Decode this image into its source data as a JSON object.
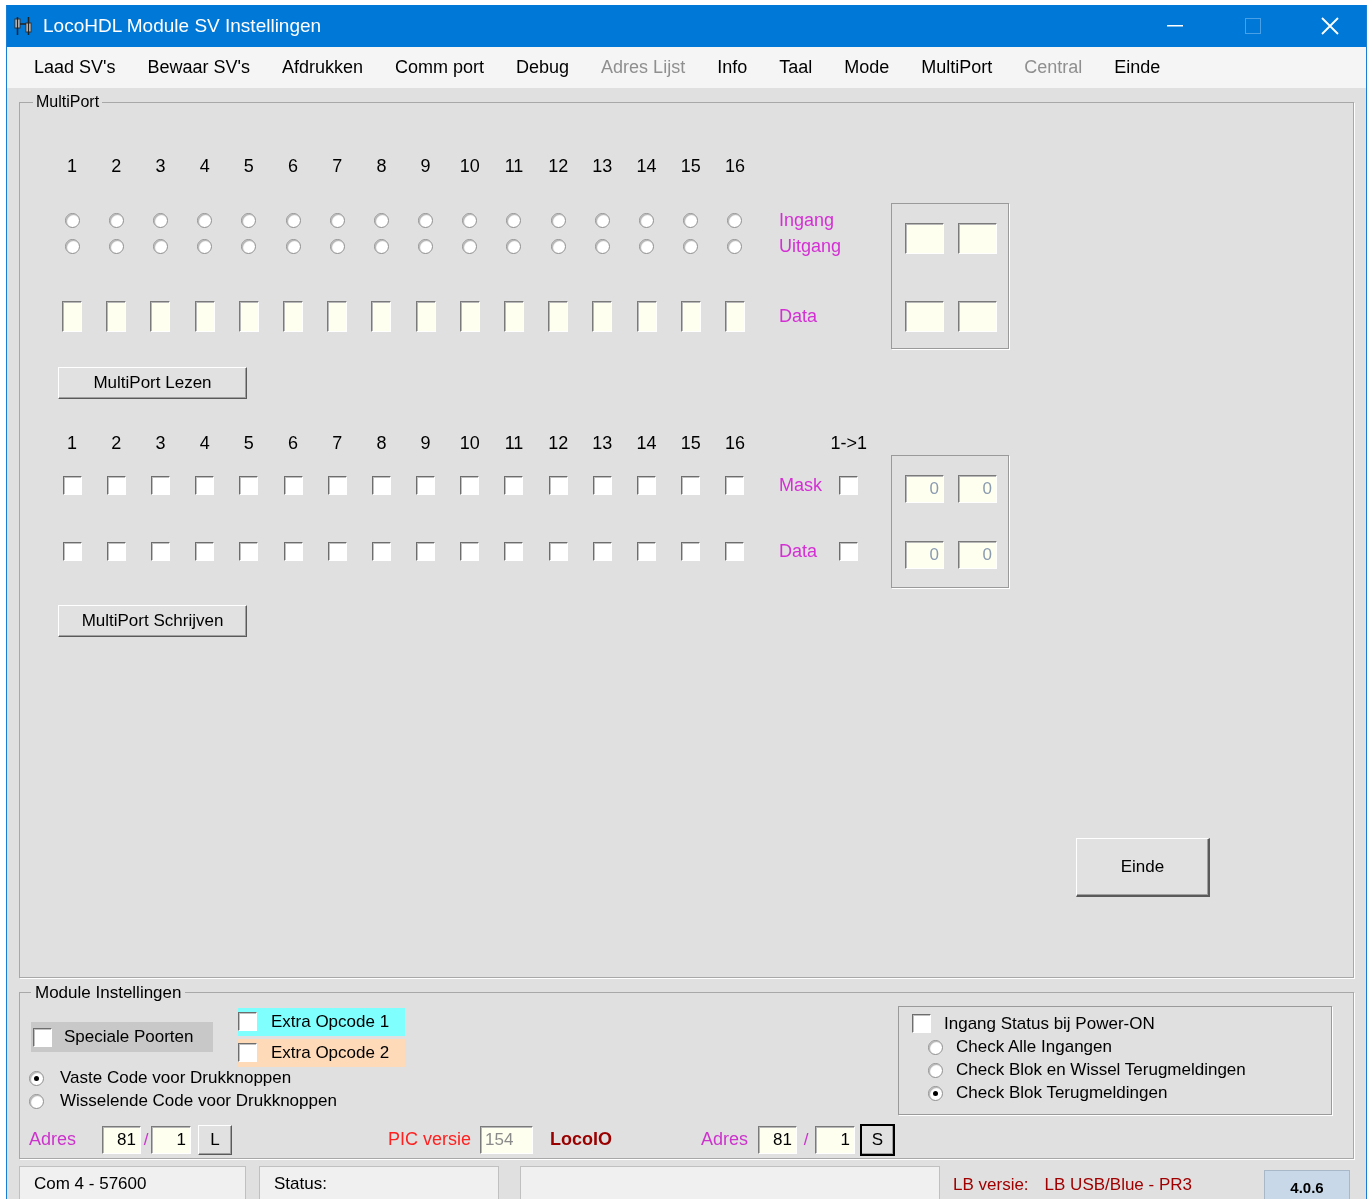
{
  "window": {
    "title": "LocoHDL Module SV Instellingen"
  },
  "menu": [
    {
      "label": "Laad SV's",
      "disabled": false
    },
    {
      "label": "Bewaar SV's",
      "disabled": false
    },
    {
      "label": "Afdrukken",
      "disabled": false
    },
    {
      "label": "Comm port",
      "disabled": false
    },
    {
      "label": "Debug",
      "disabled": false
    },
    {
      "label": "Adres Lijst",
      "disabled": true
    },
    {
      "label": "Info",
      "disabled": false
    },
    {
      "label": "Taal",
      "disabled": false
    },
    {
      "label": "Mode",
      "disabled": false
    },
    {
      "label": "MultiPort",
      "disabled": false
    },
    {
      "label": "Central",
      "disabled": true
    },
    {
      "label": "Einde",
      "disabled": false
    }
  ],
  "multiport": {
    "title": "MultiPort",
    "read": {
      "ports": [
        {
          "number": "1",
          "ingang": false,
          "uitgang": false
        },
        {
          "number": "2",
          "ingang": false,
          "uitgang": false
        },
        {
          "number": "3",
          "ingang": false,
          "uitgang": false
        },
        {
          "number": "4",
          "ingang": false,
          "uitgang": false
        },
        {
          "number": "5",
          "ingang": false,
          "uitgang": false
        },
        {
          "number": "6",
          "ingang": false,
          "uitgang": false
        },
        {
          "number": "7",
          "ingang": false,
          "uitgang": false
        },
        {
          "number": "8",
          "ingang": false,
          "uitgang": false
        },
        {
          "number": "9",
          "ingang": false,
          "uitgang": false
        },
        {
          "number": "10",
          "ingang": false,
          "uitgang": false
        },
        {
          "number": "11",
          "ingang": false,
          "uitgang": false
        },
        {
          "number": "12",
          "ingang": false,
          "uitgang": false
        },
        {
          "number": "13",
          "ingang": false,
          "uitgang": false
        },
        {
          "number": "14",
          "ingang": false,
          "uitgang": false
        },
        {
          "number": "15",
          "ingang": false,
          "uitgang": false
        },
        {
          "number": "16",
          "ingang": false,
          "uitgang": false
        }
      ],
      "labels": {
        "ingang": "Ingang",
        "uitgang": "Uitgang",
        "data": "Data"
      }
    },
    "read_button": "MultiPort Lezen",
    "write": {
      "ports": [
        {
          "number": "1",
          "mask": false,
          "data": false
        },
        {
          "number": "2",
          "mask": false,
          "data": false
        },
        {
          "number": "3",
          "mask": false,
          "data": false
        },
        {
          "number": "4",
          "mask": false,
          "data": false
        },
        {
          "number": "5",
          "mask": false,
          "data": false
        },
        {
          "number": "6",
          "mask": false,
          "data": false
        },
        {
          "number": "7",
          "mask": false,
          "data": false
        },
        {
          "number": "8",
          "mask": false,
          "data": false
        },
        {
          "number": "9",
          "mask": false,
          "data": false
        },
        {
          "number": "10",
          "mask": false,
          "data": false
        },
        {
          "number": "11",
          "mask": false,
          "data": false
        },
        {
          "number": "12",
          "mask": false,
          "data": false
        },
        {
          "number": "13",
          "mask": false,
          "data": false
        },
        {
          "number": "14",
          "mask": false,
          "data": false
        },
        {
          "number": "15",
          "mask": false,
          "data": false
        },
        {
          "number": "16",
          "mask": false,
          "data": false
        }
      ],
      "one_to_one": {
        "label": "1->1",
        "mask": false,
        "data": false
      },
      "labels": {
        "mask": "Mask",
        "data": "Data"
      },
      "summary": {
        "mask": [
          "0",
          "0"
        ],
        "data": [
          "0",
          "0"
        ]
      }
    },
    "write_button": "MultiPort Schrijven",
    "close_button": "Einde"
  },
  "module": {
    "title": "Module Instellingen",
    "options": [
      {
        "label": "Speciale Poorten",
        "checked": false,
        "color": "#c8c8c8"
      },
      {
        "label": "Extra Opcode 1",
        "checked": false,
        "color": "#80ffff"
      },
      {
        "label": "Extra Opcode 2",
        "checked": false,
        "color": "#ffdab9"
      }
    ],
    "code_modes": [
      {
        "label": "Vaste Code voor Drukknoppen",
        "selected": true
      },
      {
        "label": "Wisselende Code voor Drukknoppen",
        "selected": false
      }
    ],
    "power_on": {
      "label": "Ingang Status bij Power-ON",
      "checked": false,
      "modes": [
        {
          "label": "Check Alle Ingangen",
          "selected": false
        },
        {
          "label": "Check Blok en Wissel Terugmeldingen",
          "selected": false
        },
        {
          "label": "Check Blok Terugmeldingen",
          "selected": true
        }
      ]
    },
    "address_left": {
      "label": "Adres",
      "high": "81",
      "separator": "/",
      "low": "1",
      "button": "L"
    },
    "pic": {
      "label": "PIC versie",
      "value": "154",
      "type": "LocoIO"
    },
    "address_right": {
      "label": "Adres",
      "high": "81",
      "separator": "/",
      "low": "1",
      "button": "S"
    }
  },
  "status_bar": {
    "port": "Com 4 - 57600",
    "status": "Status:",
    "lb_label": "LB versie:",
    "lb_value": "LB USB/Blue - PR3",
    "version": "4.0.6"
  }
}
